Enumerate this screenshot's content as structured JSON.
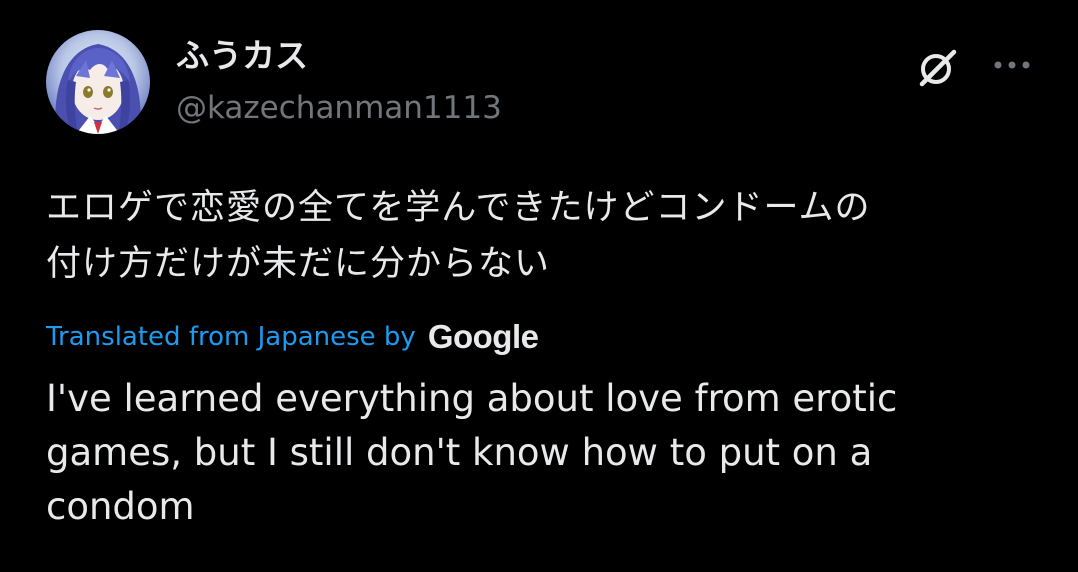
{
  "author": {
    "display_name": "ふうカス",
    "handle": "@kazechanman1113"
  },
  "icons": {
    "avatar": "anime-girl-avatar",
    "grok": "grok-icon",
    "more": "more-options-icon"
  },
  "tweet": {
    "text_lines": [
      "エロゲで恋愛の全てを学んできたけどコンドームの",
      "付け方だけが未だに分からない"
    ]
  },
  "translation": {
    "label": "Translated from Japanese by",
    "provider": "Google",
    "text_lines": [
      "I've learned everything about love from erotic",
      "games, but I still don't know how to put on a",
      "condom"
    ]
  },
  "colors": {
    "background": "#000000",
    "primary_text": "#e7e9ea",
    "secondary_text": "#71767b",
    "link": "#1d9bf0"
  }
}
